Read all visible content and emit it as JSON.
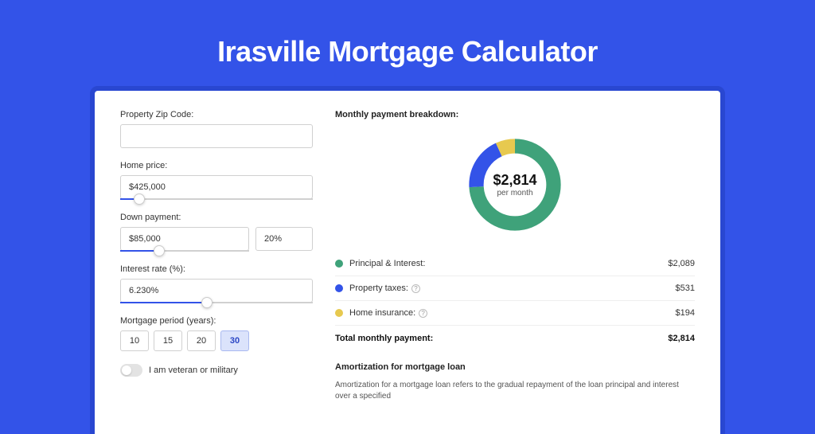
{
  "title": "Irasville Mortgage Calculator",
  "form": {
    "zip_label": "Property Zip Code:",
    "zip_value": "",
    "price_label": "Home price:",
    "price_value": "$425,000",
    "price_slider_pct": 10,
    "down_label": "Down payment:",
    "down_value": "$85,000",
    "down_pct_value": "20%",
    "down_slider_pct": 30,
    "rate_label": "Interest rate (%):",
    "rate_value": "6.230%",
    "rate_slider_pct": 45,
    "period_label": "Mortgage period (years):",
    "periods": [
      "10",
      "15",
      "20",
      "30"
    ],
    "period_active": 3,
    "veteran_label": "I am veteran or military"
  },
  "breakdown": {
    "title": "Monthly payment breakdown:",
    "center_value": "$2,814",
    "center_sub": "per month",
    "items": [
      {
        "label": "Principal & Interest:",
        "value": "$2,089",
        "color": "#3fa27a",
        "has_info": false,
        "pct": 74
      },
      {
        "label": "Property taxes:",
        "value": "$531",
        "color": "#3353e8",
        "has_info": true,
        "pct": 19
      },
      {
        "label": "Home insurance:",
        "value": "$194",
        "color": "#e7c94f",
        "has_info": true,
        "pct": 7
      }
    ],
    "total_label": "Total monthly payment:",
    "total_value": "$2,814"
  },
  "amort": {
    "title": "Amortization for mortgage loan",
    "text": "Amortization for a mortgage loan refers to the gradual repayment of the loan principal and interest over a specified"
  },
  "chart_data": {
    "type": "pie",
    "title": "Monthly payment breakdown",
    "series": [
      {
        "name": "Principal & Interest",
        "value": 2089
      },
      {
        "name": "Property taxes",
        "value": 531
      },
      {
        "name": "Home insurance",
        "value": 194
      }
    ],
    "total": 2814,
    "unit": "USD/month"
  }
}
